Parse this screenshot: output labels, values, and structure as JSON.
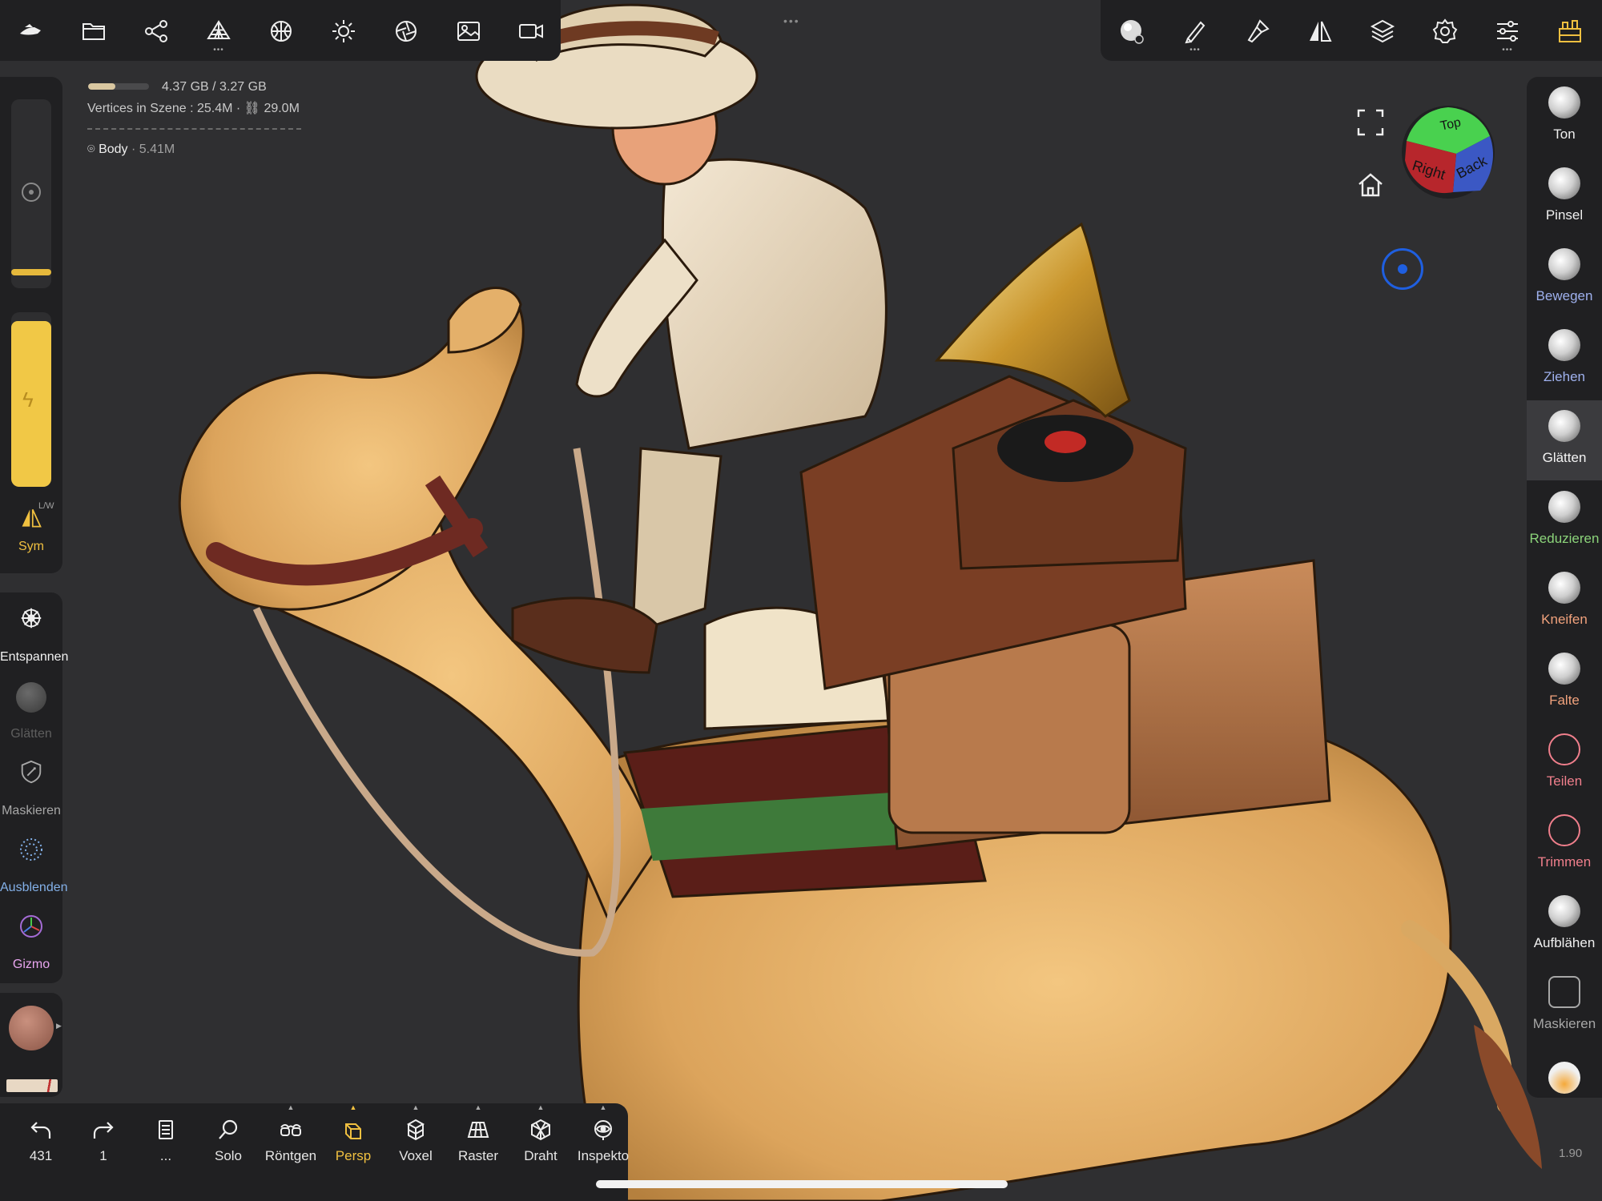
{
  "top_left_toolbar": [
    {
      "id": "nomad-logo",
      "has_dots": false
    },
    {
      "id": "folder-icon",
      "has_dots": false
    },
    {
      "id": "scene-tree-icon",
      "has_dots": false
    },
    {
      "id": "topology-icon",
      "has_dots": true
    },
    {
      "id": "material-icon",
      "has_dots": false
    },
    {
      "id": "light-icon",
      "has_dots": false
    },
    {
      "id": "camera-aperture-icon",
      "has_dots": false
    },
    {
      "id": "image-icon",
      "has_dots": false
    },
    {
      "id": "video-camera-icon",
      "has_dots": false
    }
  ],
  "top_right_toolbar": [
    {
      "id": "current-brush-icon",
      "has_dots": false
    },
    {
      "id": "brush-stroke-icon",
      "has_dots": true
    },
    {
      "id": "paint-icon",
      "has_dots": false
    },
    {
      "id": "symmetry-icon",
      "has_dots": false
    },
    {
      "id": "layers-icon",
      "has_dots": false
    },
    {
      "id": "settings-gear-icon",
      "has_dots": false
    },
    {
      "id": "sliders-icon",
      "has_dots": true
    },
    {
      "id": "interface-icon",
      "has_dots": false
    }
  ],
  "stats": {
    "memory": "4.37 GB / 3.27 GB",
    "memory_fraction": 0.45,
    "vertices_label": "Vertices in Szene :",
    "vertices_value": "25.4M",
    "vertices_linked": "29.0M",
    "object_name": "Body",
    "object_vertices": "5.41M"
  },
  "viewcube": {
    "face_back": "Back",
    "face_right": "Right",
    "face_top": "Top"
  },
  "left_panel": {
    "sym_label": "Sym",
    "sym_hint": "L/W",
    "radius_level": 0.1,
    "intensity_level": 0.95,
    "tools": [
      {
        "label": "Entspannen",
        "color": "#f2f2f2"
      },
      {
        "label": "Glätten",
        "color": "#5e5e5e"
      },
      {
        "label": "Maskieren",
        "color": "#a7a7a7"
      },
      {
        "label": "Ausblenden",
        "color": "#83b0e8"
      },
      {
        "label": "Gizmo",
        "color": "#e9a6f0"
      }
    ]
  },
  "right_tools": [
    {
      "label": "Ton",
      "color": "#f0f0f0",
      "selected": false
    },
    {
      "label": "Pinsel",
      "color": "#f0f0f0",
      "selected": false
    },
    {
      "label": "Bewegen",
      "color": "#9fb1ee",
      "selected": false
    },
    {
      "label": "Ziehen",
      "color": "#9fb1ee",
      "selected": false
    },
    {
      "label": "Glätten",
      "color": "#f4f4f4",
      "selected": true
    },
    {
      "label": "Reduzieren",
      "color": "#8bd37a",
      "selected": false
    },
    {
      "label": "Kneifen",
      "color": "#f1a27d",
      "selected": false
    },
    {
      "label": "Falte",
      "color": "#f1a27d",
      "selected": false
    },
    {
      "label": "Teilen",
      "color": "#f07f8c",
      "selected": false
    },
    {
      "label": "Trimmen",
      "color": "#f07f8c",
      "selected": false
    },
    {
      "label": "Aufblähen",
      "color": "#f0f0f0",
      "selected": false
    },
    {
      "label": "Maskieren",
      "color": "#a7a7a7",
      "selected": false
    }
  ],
  "bottom_bar": [
    {
      "icon": "undo-icon",
      "label": "431",
      "active": false
    },
    {
      "icon": "redo-icon",
      "label": "1",
      "active": false
    },
    {
      "icon": "history-icon",
      "label": "...",
      "active": false
    },
    {
      "icon": "search-icon",
      "label": "Solo",
      "active": false
    },
    {
      "icon": "glasses-icon",
      "label": "Röntgen",
      "active": false
    },
    {
      "icon": "perspective-cube-icon",
      "label": "Persp",
      "active": true
    },
    {
      "icon": "voxel-icon",
      "label": "Voxel",
      "active": false
    },
    {
      "icon": "grid-icon",
      "label": "Raster",
      "active": false
    },
    {
      "icon": "wireframe-icon",
      "label": "Draht",
      "active": false
    },
    {
      "icon": "inspector-icon",
      "label": "Inspekto",
      "active": false
    }
  ],
  "zoom_readout": "1.90",
  "accent_color": "#f0c040"
}
